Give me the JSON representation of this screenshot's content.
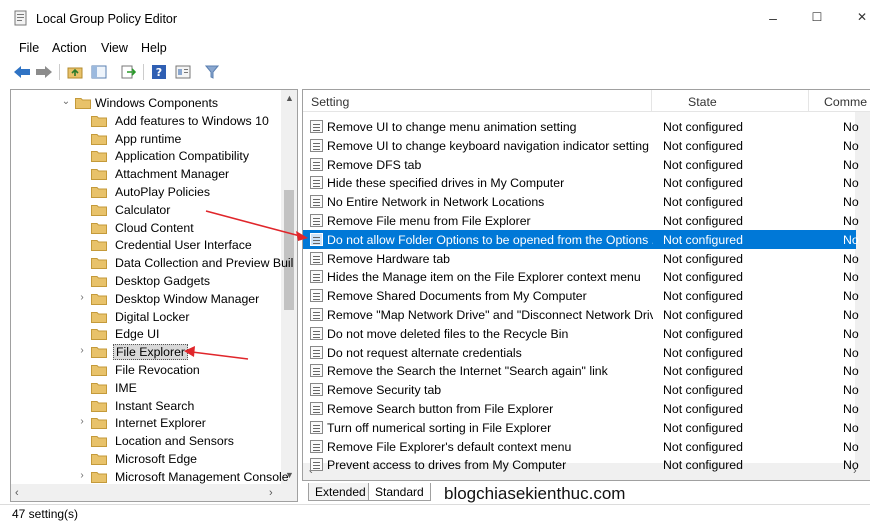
{
  "window": {
    "title": "Local Group Policy Editor",
    "minimize": "–",
    "maximize": "☐",
    "close": "✕"
  },
  "menu": [
    "File",
    "Action",
    "View",
    "Help"
  ],
  "toolbar": {
    "icons": [
      "back-icon",
      "forward-icon",
      "up-folder-icon",
      "show-hide-tree-icon",
      "export-list-icon",
      "help-icon",
      "properties-icon",
      "filter-icon"
    ]
  },
  "tree": {
    "items": [
      {
        "label": "Windows Components",
        "expander": "⌄"
      },
      {
        "label": "Add features to Windows 10",
        "expander": ""
      },
      {
        "label": "App runtime",
        "expander": ""
      },
      {
        "label": "Application Compatibility",
        "expander": ""
      },
      {
        "label": "Attachment Manager",
        "expander": ""
      },
      {
        "label": "AutoPlay Policies",
        "expander": ""
      },
      {
        "label": "Calculator",
        "expander": ""
      },
      {
        "label": "Cloud Content",
        "expander": ""
      },
      {
        "label": "Credential User Interface",
        "expander": ""
      },
      {
        "label": "Data Collection and Preview Buil",
        "expander": ""
      },
      {
        "label": "Desktop Gadgets",
        "expander": ""
      },
      {
        "label": "Desktop Window Manager",
        "expander": "›"
      },
      {
        "label": "Digital Locker",
        "expander": ""
      },
      {
        "label": "Edge UI",
        "expander": ""
      },
      {
        "label": "File Explorer",
        "expander": "›"
      },
      {
        "label": "File Revocation",
        "expander": ""
      },
      {
        "label": "IME",
        "expander": ""
      },
      {
        "label": "Instant Search",
        "expander": ""
      },
      {
        "label": "Internet Explorer",
        "expander": "›"
      },
      {
        "label": "Location and Sensors",
        "expander": ""
      },
      {
        "label": "Microsoft Edge",
        "expander": ""
      },
      {
        "label": "Microsoft Management Console",
        "expander": "›"
      }
    ]
  },
  "list": {
    "columns": {
      "setting": "Setting",
      "state": "State",
      "comment": "Comme"
    },
    "rows": [
      {
        "setting": "Remove UI to change menu animation setting",
        "state": "Not configured",
        "comment": "No"
      },
      {
        "setting": "Remove UI to change keyboard navigation indicator setting",
        "state": "Not configured",
        "comment": "No"
      },
      {
        "setting": "Remove DFS tab",
        "state": "Not configured",
        "comment": "No"
      },
      {
        "setting": "Hide these specified drives in My Computer",
        "state": "Not configured",
        "comment": "No"
      },
      {
        "setting": "No Entire Network in Network Locations",
        "state": "Not configured",
        "comment": "No"
      },
      {
        "setting": "Remove File menu from File Explorer",
        "state": "Not configured",
        "comment": "No"
      },
      {
        "setting": "Do not allow Folder Options to be opened from the Options ...",
        "state": "Not configured",
        "comment": "No"
      },
      {
        "setting": "Remove Hardware tab",
        "state": "Not configured",
        "comment": "No"
      },
      {
        "setting": "Hides the Manage item on the File Explorer context menu",
        "state": "Not configured",
        "comment": "No"
      },
      {
        "setting": "Remove Shared Documents from My Computer",
        "state": "Not configured",
        "comment": "No"
      },
      {
        "setting": "Remove \"Map Network Drive\" and \"Disconnect Network Drive\"",
        "state": "Not configured",
        "comment": "No"
      },
      {
        "setting": "Do not move deleted files to the Recycle Bin",
        "state": "Not configured",
        "comment": "No"
      },
      {
        "setting": "Do not request alternate credentials",
        "state": "Not configured",
        "comment": "No"
      },
      {
        "setting": "Remove the Search the Internet \"Search again\" link",
        "state": "Not configured",
        "comment": "No"
      },
      {
        "setting": "Remove Security tab",
        "state": "Not configured",
        "comment": "No"
      },
      {
        "setting": "Remove Search button from File Explorer",
        "state": "Not configured",
        "comment": "No"
      },
      {
        "setting": "Turn off numerical sorting in File Explorer",
        "state": "Not configured",
        "comment": "No"
      },
      {
        "setting": "Remove File Explorer's default context menu",
        "state": "Not configured",
        "comment": "No"
      },
      {
        "setting": "Prevent access to drives from My Computer",
        "state": "Not configured",
        "comment": "No"
      }
    ]
  },
  "tabs": [
    "Extended",
    "Standard"
  ],
  "watermark": "blogchiasekienthuc.com",
  "status": "47 setting(s)",
  "colors": {
    "selection": "#0078d7",
    "annotation_arrow": "#e0262b",
    "folder": "#e8c26a"
  }
}
